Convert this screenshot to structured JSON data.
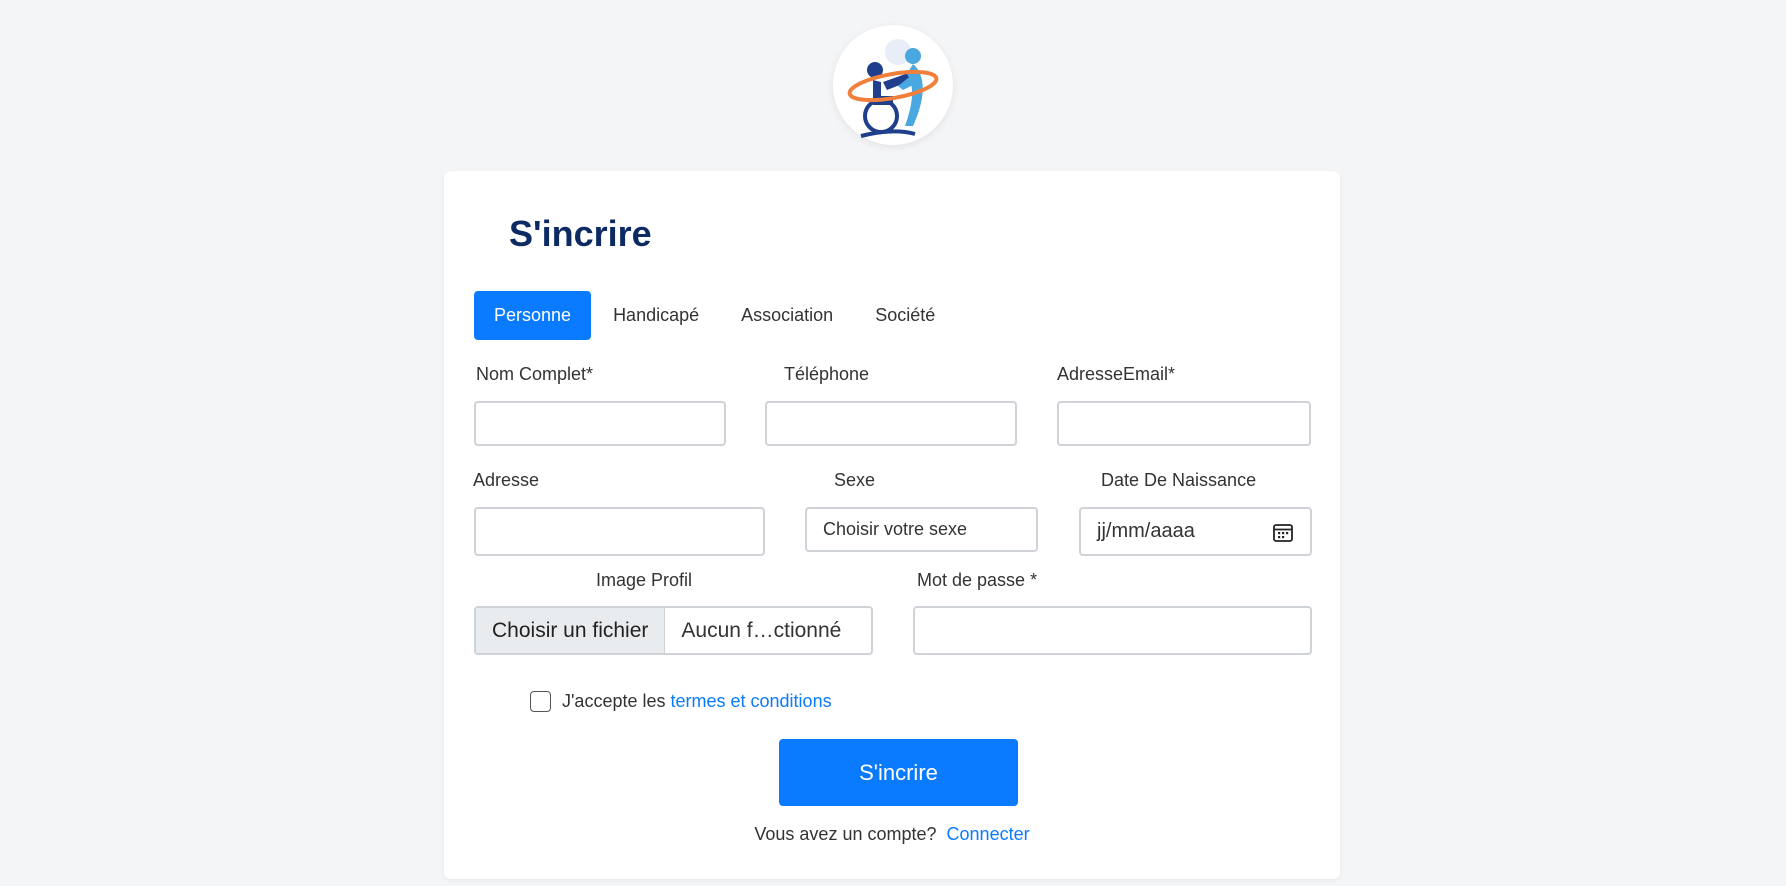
{
  "title": "S'incrire",
  "tabs": [
    "Personne",
    "Handicapé",
    "Association",
    "Société"
  ],
  "form": {
    "nom_label": "Nom Complet*",
    "tel_label": "Téléphone",
    "email_label": "AdresseEmail*",
    "adresse_label": "Adresse",
    "sexe_label": "Sexe",
    "sexe_value": "Choisir votre sexe",
    "date_label": "Date De Naissance",
    "date_placeholder": "jj/mm/aaaa",
    "image_label": "Image Profil",
    "file_button": "Choisir un fichier",
    "file_name": "Aucun f…ctionné",
    "password_label": "Mot de passe *"
  },
  "terms": {
    "text": "J'accepte les",
    "link": "termes et conditions"
  },
  "submit_label": "S'incrire",
  "login": {
    "text": "Vous avez un compte?",
    "link": "Connecter"
  },
  "colors": {
    "primary": "#0a7bff",
    "title": "#0d2a63",
    "logo_orange": "#f07f3c",
    "logo_navy": "#1f3f8c",
    "logo_light_blue": "#4aa8e0"
  }
}
